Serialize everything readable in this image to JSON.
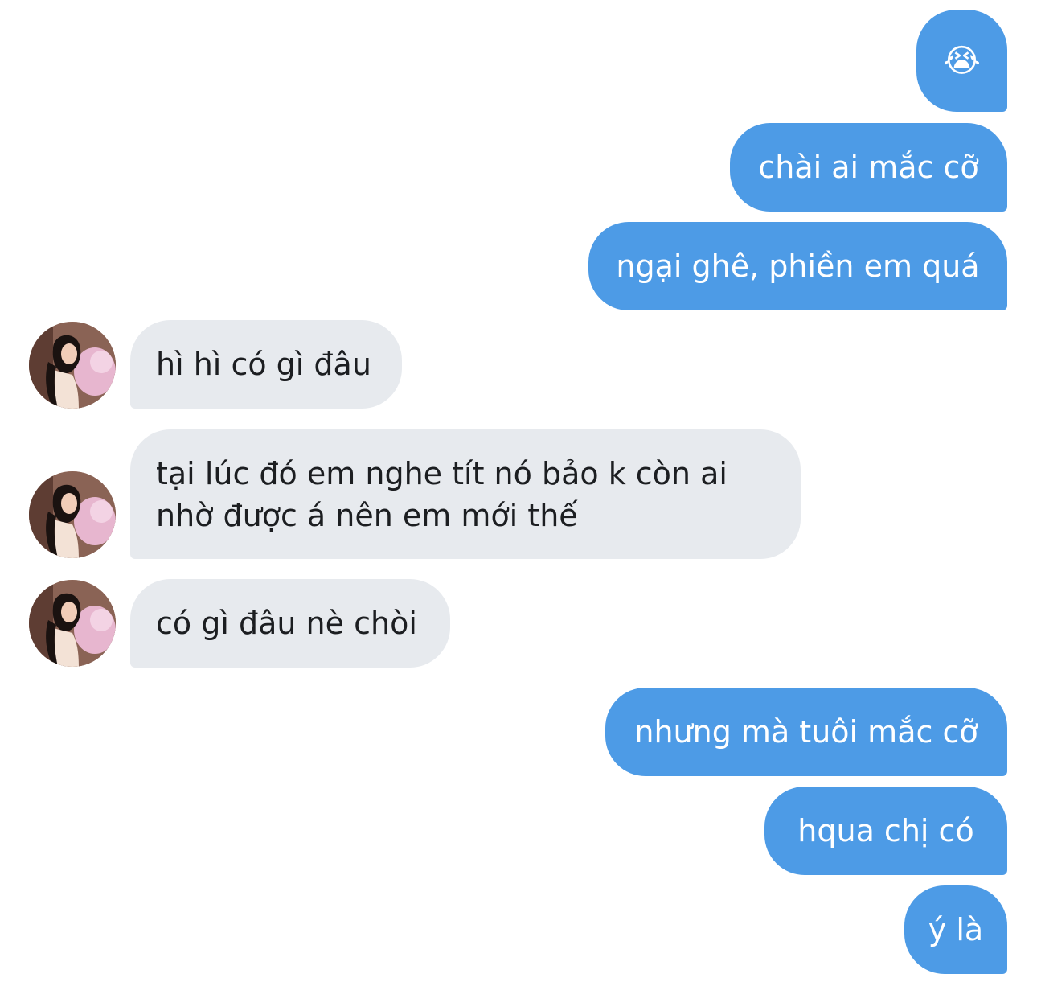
{
  "conversation": {
    "messages": [
      {
        "side": "sent",
        "text": "😭"
      },
      {
        "side": "sent",
        "text": "chài ai mắc cỡ"
      },
      {
        "side": "sent",
        "text": "ngại ghê, phiền em quá"
      },
      {
        "side": "received",
        "text": "hì hì có gì đâu"
      },
      {
        "side": "received",
        "text": "tại lúc đó em nghe tít nó bảo k còn ai nhờ được á nên em mới thế"
      },
      {
        "side": "received",
        "text": "có gì đâu nè chòi"
      },
      {
        "side": "sent",
        "text": "nhưng mà tuôi mắc cỡ"
      },
      {
        "side": "sent",
        "text": "hqua chị có"
      },
      {
        "side": "sent",
        "text": "ý là"
      }
    ]
  },
  "colors": {
    "sent_bubble": "#4d9be6",
    "received_bubble": "#e7eaee",
    "sent_text": "#ffffff",
    "received_text": "#1c1e21",
    "background": "#ffffff"
  },
  "icons": {
    "contact_avatar": "avatar-photo"
  }
}
